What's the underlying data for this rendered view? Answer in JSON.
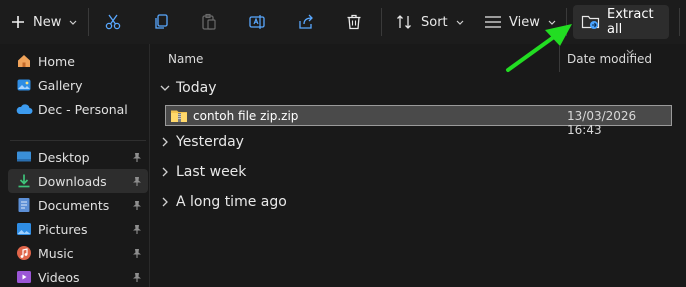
{
  "toolbar": {
    "new_label": "New",
    "sort_label": "Sort",
    "view_label": "View",
    "extract_label": "Extract all",
    "icons": [
      "cut-icon",
      "copy-icon",
      "paste-icon",
      "rename-icon",
      "share-icon",
      "delete-icon"
    ]
  },
  "sidebar": {
    "top_items": [
      {
        "label": "Home",
        "icon": "home-icon"
      },
      {
        "label": "Gallery",
        "icon": "gallery-icon"
      },
      {
        "label": "Dec - Personal",
        "icon": "cloud-icon"
      }
    ],
    "quick_access": [
      {
        "label": "Desktop",
        "icon": "desktop-icon",
        "pinned": true
      },
      {
        "label": "Downloads",
        "icon": "download-icon",
        "pinned": true,
        "selected": true
      },
      {
        "label": "Documents",
        "icon": "documents-icon",
        "pinned": true
      },
      {
        "label": "Pictures",
        "icon": "pictures-icon",
        "pinned": true
      },
      {
        "label": "Music",
        "icon": "music-icon",
        "pinned": true
      },
      {
        "label": "Videos",
        "icon": "videos-icon",
        "pinned": true
      }
    ]
  },
  "columns": {
    "name": "Name",
    "date_modified": "Date modified"
  },
  "groups": {
    "today": "Today",
    "yesterday": "Yesterday",
    "last_week": "Last week",
    "long_ago": "A long time ago"
  },
  "files": [
    {
      "name": "contoh file zip.zip",
      "date_modified": "13/03/2026 16:43",
      "icon": "zip-folder-icon"
    }
  ],
  "colors": {
    "background": "#191919",
    "selected_row": "#4a4a4a",
    "annotation_arrow": "#22dd22",
    "accent_blue": "#4aa3ff"
  }
}
